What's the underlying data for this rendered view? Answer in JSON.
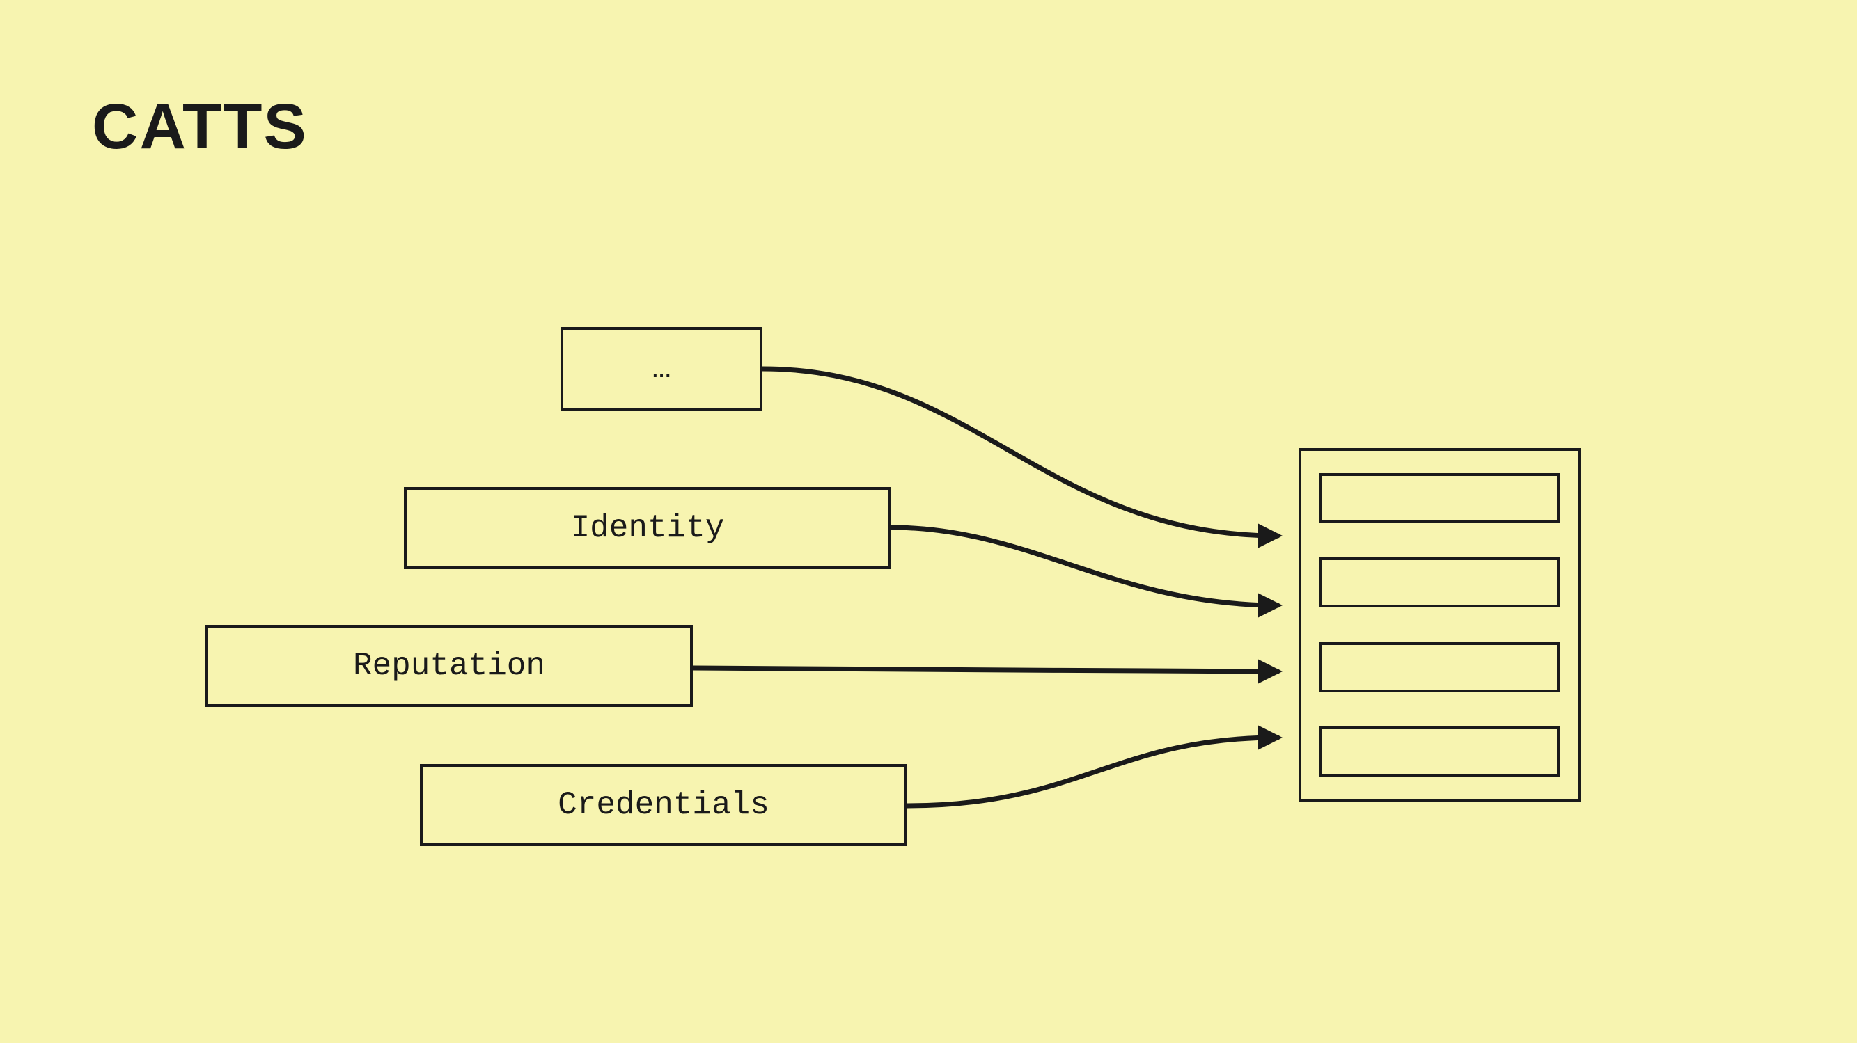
{
  "title": "CATTS",
  "sources": [
    {
      "label": "…"
    },
    {
      "label": "Identity"
    },
    {
      "label": "Reputation"
    },
    {
      "label": "Credentials"
    }
  ],
  "target": {
    "slot_count": 4
  },
  "colors": {
    "background": "#f7f4b0",
    "stroke": "#1a1a1a"
  }
}
